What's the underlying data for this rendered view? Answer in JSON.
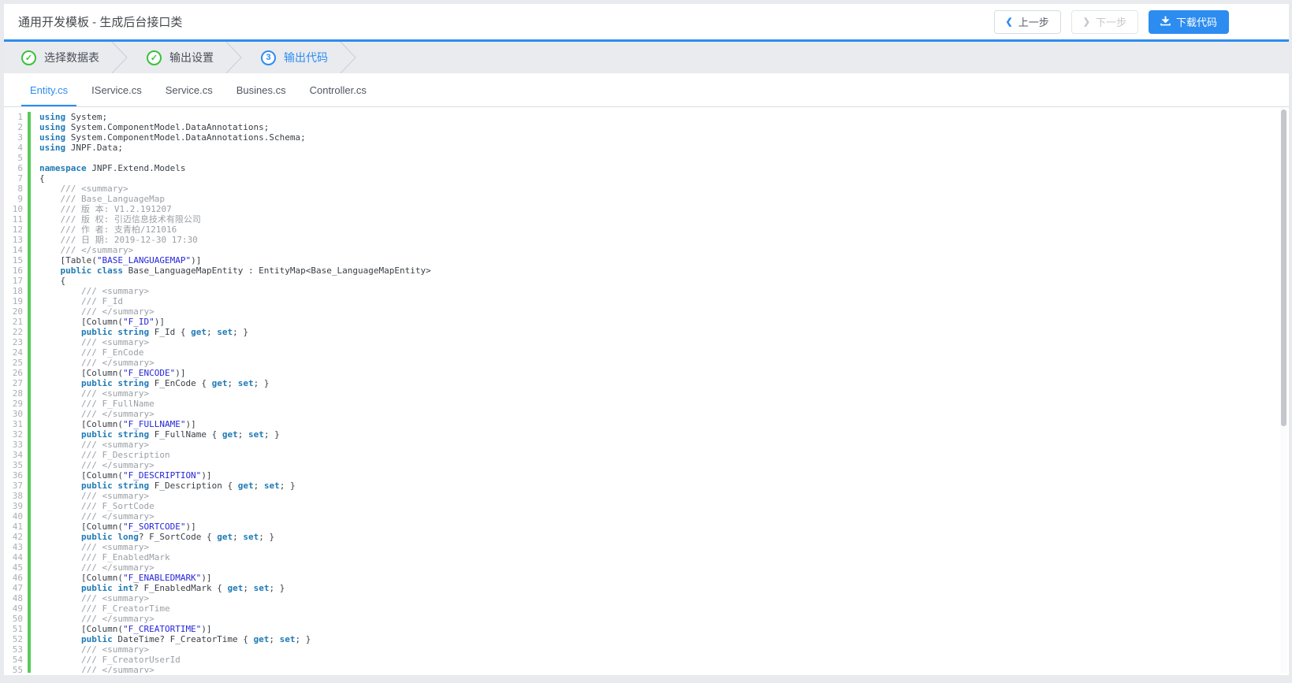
{
  "header": {
    "title": "通用开发模板 - 生成后台接口类",
    "buttons": {
      "prev": "上一步",
      "next": "下一步",
      "download": "下载代码"
    }
  },
  "steps": {
    "items": [
      {
        "label": "选择数据表",
        "status": "done",
        "marker": "✓"
      },
      {
        "label": "输出设置",
        "status": "done",
        "marker": "✓"
      },
      {
        "label": "输出代码",
        "status": "active",
        "marker": "3"
      }
    ]
  },
  "tabs": {
    "items": [
      {
        "label": "Entity.cs",
        "active": true
      },
      {
        "label": "IService.cs",
        "active": false
      },
      {
        "label": "Service.cs",
        "active": false
      },
      {
        "label": "Busines.cs",
        "active": false
      },
      {
        "label": "Controller.cs",
        "active": false
      }
    ]
  },
  "editor": {
    "language": "csharp",
    "keywords": [
      "using",
      "namespace",
      "public",
      "class",
      "string",
      "long",
      "int",
      "get",
      "set"
    ],
    "lines": [
      "using System;",
      "using System.ComponentModel.DataAnnotations;",
      "using System.ComponentModel.DataAnnotations.Schema;",
      "using JNPF.Data;",
      "",
      "namespace JNPF.Extend.Models",
      "{",
      "    /// <summary>",
      "    /// Base_LanguageMap",
      "    /// 版 本: V1.2.191207",
      "    /// 版 权: 引迈信息技术有限公司",
      "    /// 作 者: 支青柏/121016",
      "    /// 日 期: 2019-12-30 17:30",
      "    /// </summary>",
      "    [Table(\"BASE_LANGUAGEMAP\")]",
      "    public class Base_LanguageMapEntity : EntityMap<Base_LanguageMapEntity>",
      "    {",
      "        /// <summary>",
      "        /// F_Id",
      "        /// </summary>",
      "        [Column(\"F_ID\")]",
      "        public string F_Id { get; set; }",
      "        /// <summary>",
      "        /// F_EnCode",
      "        /// </summary>",
      "        [Column(\"F_ENCODE\")]",
      "        public string F_EnCode { get; set; }",
      "        /// <summary>",
      "        /// F_FullName",
      "        /// </summary>",
      "        [Column(\"F_FULLNAME\")]",
      "        public string F_FullName { get; set; }",
      "        /// <summary>",
      "        /// F_Description",
      "        /// </summary>",
      "        [Column(\"F_DESCRIPTION\")]",
      "        public string F_Description { get; set; }",
      "        /// <summary>",
      "        /// F_SortCode",
      "        /// </summary>",
      "        [Column(\"F_SORTCODE\")]",
      "        public long? F_SortCode { get; set; }",
      "        /// <summary>",
      "        /// F_EnabledMark",
      "        /// </summary>",
      "        [Column(\"F_ENABLEDMARK\")]",
      "        public int? F_EnabledMark { get; set; }",
      "        /// <summary>",
      "        /// F_CreatorTime",
      "        /// </summary>",
      "        [Column(\"F_CREATORTIME\")]",
      "        public DateTime? F_CreatorTime { get; set; }",
      "        /// <summary>",
      "        /// F_CreatorUserId",
      "        /// </summary>"
    ],
    "colors": {
      "accent": "#2d8cf0",
      "step_done_green": "#39c239",
      "gutter_bar_green": "#57cb57",
      "keyword": "#1f7ab6",
      "string": "#2626d9",
      "comment": "#9a9fa6",
      "text": "#393f45",
      "line_number": "#a9aeb5"
    }
  }
}
